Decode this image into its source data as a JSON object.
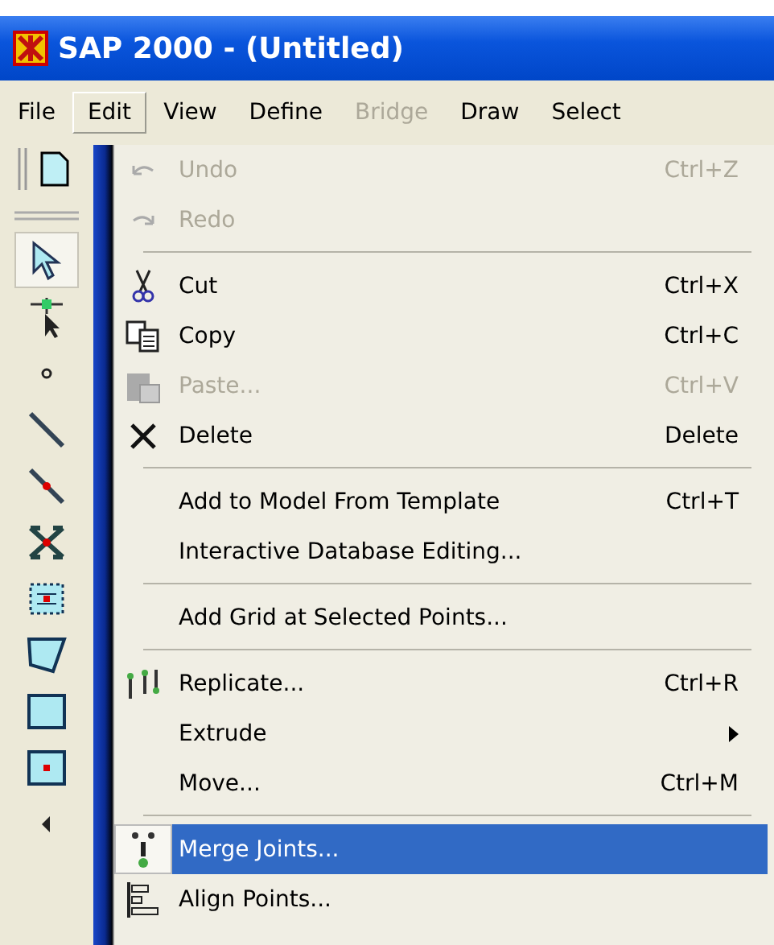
{
  "window": {
    "title": "SAP 2000 - (Untitled)"
  },
  "menu_bar": [
    {
      "label": "File",
      "selected": false,
      "disabled": false
    },
    {
      "label": "Edit",
      "selected": true,
      "disabled": false
    },
    {
      "label": "View",
      "selected": false,
      "disabled": false
    },
    {
      "label": "Define",
      "selected": false,
      "disabled": false
    },
    {
      "label": "Bridge",
      "selected": false,
      "disabled": true
    },
    {
      "label": "Draw",
      "selected": false,
      "disabled": false
    },
    {
      "label": "Select",
      "selected": false,
      "disabled": false
    }
  ],
  "edit_menu": [
    {
      "kind": "item",
      "label": "Undo",
      "shortcut": "Ctrl+Z",
      "disabled": true,
      "selected": false
    },
    {
      "kind": "item",
      "label": "Redo",
      "disabled": true,
      "selected": false
    },
    {
      "kind": "separator"
    },
    {
      "kind": "item",
      "label": "Cut",
      "shortcut": "Ctrl+X",
      "disabled": false,
      "selected": false
    },
    {
      "kind": "item",
      "label": "Copy",
      "shortcut": "Ctrl+C",
      "disabled": false,
      "selected": false
    },
    {
      "kind": "item",
      "label": "Paste...",
      "shortcut": "Ctrl+V",
      "disabled": true,
      "selected": false
    },
    {
      "kind": "item",
      "label": "Delete",
      "shortcut": "Delete",
      "disabled": false,
      "selected": false
    },
    {
      "kind": "separator"
    },
    {
      "kind": "item",
      "label": "Add to Model From Template",
      "shortcut": "Ctrl+T",
      "disabled": false,
      "selected": false
    },
    {
      "kind": "item",
      "label": "Interactive Database Editing...",
      "disabled": false,
      "selected": false
    },
    {
      "kind": "separator"
    },
    {
      "kind": "item",
      "label": "Add Grid at Selected Points...",
      "disabled": false,
      "selected": false
    },
    {
      "kind": "separator"
    },
    {
      "kind": "item",
      "label": "Replicate...",
      "shortcut": "Ctrl+R",
      "disabled": false,
      "selected": false
    },
    {
      "kind": "item",
      "label": "Extrude",
      "submenu": true,
      "disabled": false,
      "selected": false
    },
    {
      "kind": "item",
      "label": "Move...",
      "shortcut": "Ctrl+M",
      "disabled": false,
      "selected": false
    },
    {
      "kind": "separator"
    },
    {
      "kind": "item",
      "label": "Merge Joints...",
      "disabled": false,
      "selected": true
    },
    {
      "kind": "item",
      "label": "Align Points...",
      "disabled": false,
      "selected": false
    }
  ]
}
